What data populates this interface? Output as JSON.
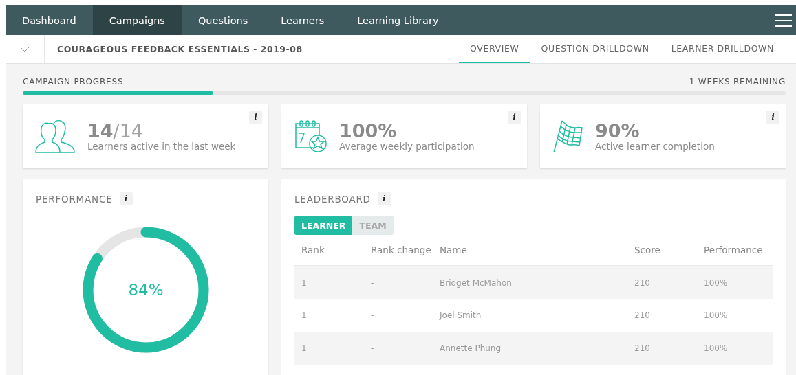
{
  "nav": {
    "items": [
      {
        "label": "Dashboard",
        "selected": false
      },
      {
        "label": "Campaigns",
        "selected": true
      },
      {
        "label": "Questions",
        "selected": false
      },
      {
        "label": "Learners",
        "selected": false
      },
      {
        "label": "Learning Library",
        "selected": false
      }
    ]
  },
  "subheader": {
    "title": "COURAGEOUS FEEDBACK ESSENTIALS - 2019-08",
    "tabs": [
      {
        "label": "OVERVIEW",
        "selected": true
      },
      {
        "label": "QUESTION DRILLDOWN",
        "selected": false
      },
      {
        "label": "LEARNER DRILLDOWN",
        "selected": false
      }
    ]
  },
  "progress": {
    "label": "CAMPAIGN PROGRESS",
    "remaining": "1 WEEKS REMAINING",
    "level": 0.25
  },
  "stats": [
    {
      "kind": "learners",
      "value": "14",
      "total": "/14",
      "caption": "Learners active in the last week",
      "info": "i"
    },
    {
      "kind": "calendar",
      "value": "100%",
      "caption": "Average weekly participation",
      "info": "i"
    },
    {
      "kind": "flag",
      "value": "90%",
      "caption": "Active learner completion",
      "info": "i"
    }
  ],
  "performance": {
    "title": "PERFORMANCE",
    "info": "i",
    "level": 0.84,
    "reading": "84%"
  },
  "leaderboard": {
    "title": "LEADERBOARD",
    "info": "i",
    "toggle": [
      {
        "label": "LEARNER",
        "selected": true
      },
      {
        "label": "TEAM",
        "selected": false
      }
    ],
    "columns": [
      "Rank",
      "Rank change",
      "Name",
      "Score",
      "Performance"
    ],
    "rows": [
      [
        "1",
        "-",
        "Bridget McMahon",
        "210",
        "100%"
      ],
      [
        "1",
        "-",
        "Joel Smith",
        "210",
        "100%"
      ],
      [
        "1",
        "-",
        "Annette Phung",
        "210",
        "100%"
      ]
    ]
  }
}
